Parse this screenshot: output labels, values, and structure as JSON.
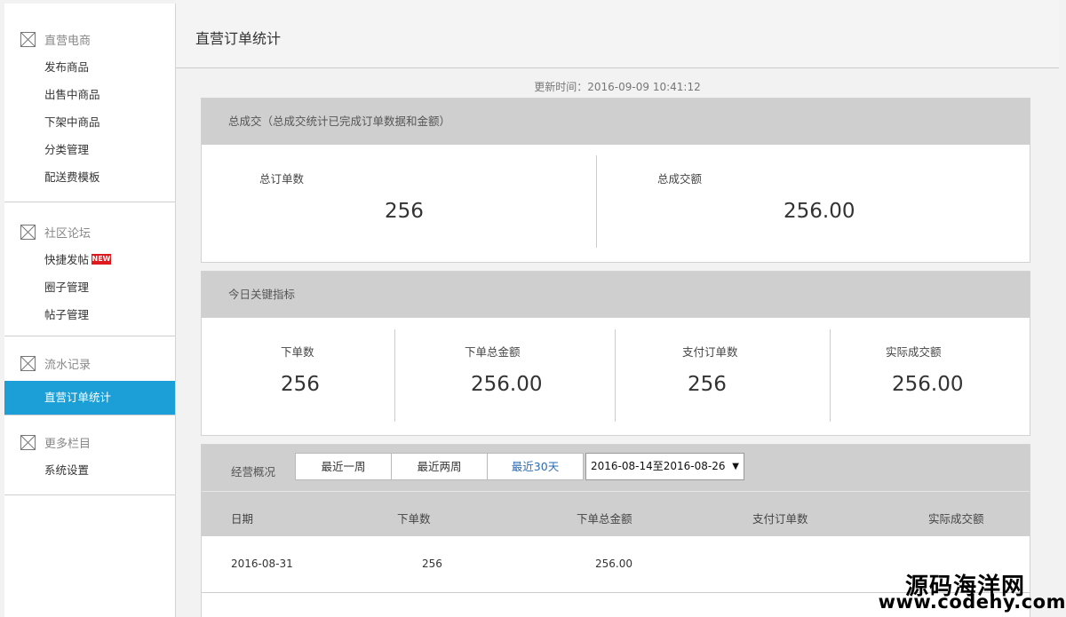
{
  "sidebar": {
    "groups": [
      {
        "title": "直营电商",
        "items": [
          "发布商品",
          "出售中商品",
          "下架中商品",
          "分类管理",
          "配送费模板"
        ]
      },
      {
        "title": "社区论坛",
        "items": [
          "快捷发帖",
          "圈子管理",
          "帖子管理"
        ],
        "badge": "NEW"
      },
      {
        "title": "流水记录",
        "items": [
          "直营订单统计"
        ]
      },
      {
        "title": "更多栏目",
        "items": [
          "系统设置"
        ]
      }
    ],
    "active_item": "直营订单统计"
  },
  "page": {
    "title": "直营订单统计",
    "update_time": "更新时间：2016-09-09 10:41:12"
  },
  "total": {
    "header": "总成交（总成交统计已完成订单数据和金额）",
    "stats": [
      {
        "label": "总订单数",
        "value": "256"
      },
      {
        "label": "总成交额",
        "value": "256.00"
      }
    ]
  },
  "today": {
    "header": "今日关键指标",
    "stats": [
      {
        "label": "下单数",
        "value": "256"
      },
      {
        "label": "下单总金额",
        "value": "256.00"
      },
      {
        "label": "支付订单数",
        "value": "256"
      },
      {
        "label": "实际成交额",
        "value": "256.00"
      }
    ]
  },
  "overview": {
    "title": "经营概况",
    "ranges": [
      "最近一周",
      "最近两周",
      "最近30天"
    ],
    "active_range": "最近30天",
    "date_range": "2016-08-14至2016-08-26",
    "columns": [
      "日期",
      "下单数",
      "下单总金额",
      "支付订单数",
      "实际成交额"
    ],
    "rows": [
      [
        "2016-08-31",
        "256",
        "256.00",
        "",
        ""
      ]
    ]
  },
  "watermark": {
    "site_name": "源码海洋网",
    "url": "www.codehy.com"
  },
  "colors": {
    "active_nav": "#1b9fd6",
    "panel_header": "#cfcfcf",
    "badge": "#e0191f",
    "active_range_text": "#2a6bb5"
  }
}
